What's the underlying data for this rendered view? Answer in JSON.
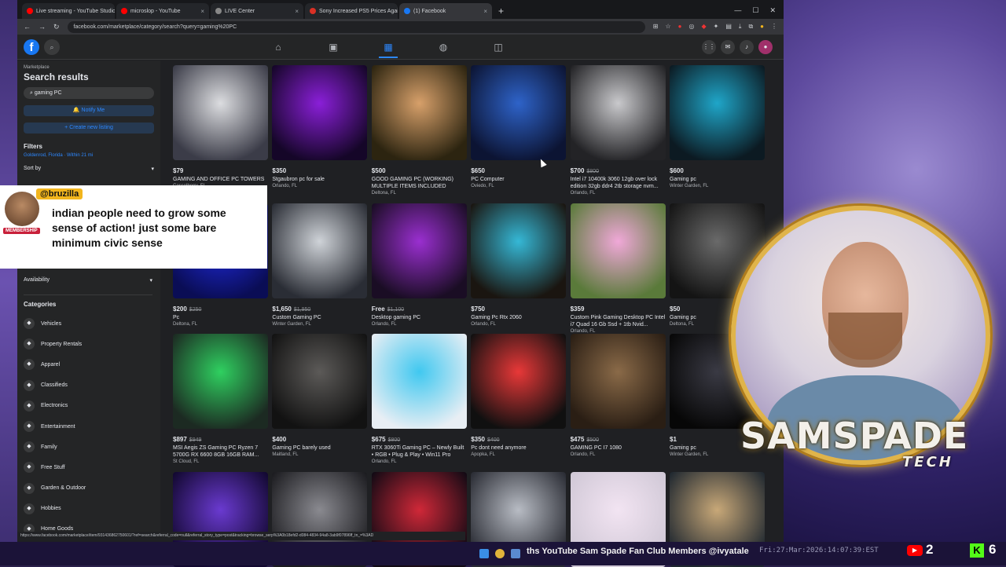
{
  "browser": {
    "tabs": [
      {
        "label": "Live streaming - YouTube Studio",
        "color": "#ff0000"
      },
      {
        "label": "microslop - YouTube",
        "color": "#ff0000"
      },
      {
        "label": "LIVE Center",
        "color": "#888888"
      },
      {
        "label": "Sony Increased PS5 Prices Again",
        "color": "#d93025"
      },
      {
        "label": "(1) Facebook",
        "color": "#1877f2"
      }
    ],
    "url": "facebook.com/marketplace/category/search?query=gaming%20PC",
    "status_url": "https://www.facebook.com/marketplace/item/931436862750601/?ref=search&referral_code=null&referral_story_type=post&tracking=browse_serp%3A0b18efd2-d084-4834-94a8-3ab9f07896ff_tn_=%3AD"
  },
  "fb": {
    "logo": "f",
    "sidebar": {
      "breadcrumb": "Marketplace",
      "title": "Search results",
      "search_value": "gaming PC",
      "notify_label": "Notify Me",
      "create_label": "Create new listing",
      "filters_label": "Filters",
      "location": "Goldenrod, Florida · Within 21 mi",
      "sort_label": "Sort by",
      "availability_label": "Availability",
      "categories_label": "Categories",
      "categories": [
        {
          "label": "Vehicles",
          "icon": "car-icon"
        },
        {
          "label": "Property Rentals",
          "icon": "house-icon"
        },
        {
          "label": "Apparel",
          "icon": "shirt-icon"
        },
        {
          "label": "Classifieds",
          "icon": "tag-icon"
        },
        {
          "label": "Electronics",
          "icon": "phone-icon"
        },
        {
          "label": "Entertainment",
          "icon": "film-icon"
        },
        {
          "label": "Family",
          "icon": "heart-icon"
        },
        {
          "label": "Free Stuff",
          "icon": "gift-icon"
        },
        {
          "label": "Garden & Outdoor",
          "icon": "leaf-icon"
        },
        {
          "label": "Hobbies",
          "icon": "guitar-icon"
        },
        {
          "label": "Home Goods",
          "icon": "sofa-icon"
        }
      ]
    },
    "listings": [
      {
        "price": "$79",
        "old": "",
        "title": "GAMING AND OFFICE PC TOWERS",
        "loc": "Casselberry, FL",
        "c1": "#dcdde0",
        "c2": "#3b3c48"
      },
      {
        "price": "$350",
        "old": "",
        "title": "Stgaubron pc for sale",
        "loc": "Orlando, FL",
        "c1": "#8a1fd8",
        "c2": "#150628"
      },
      {
        "price": "$500",
        "old": "",
        "title": "GOOD GAMING PC (WORKING) MULTIPLE ITEMS INCLUDED",
        "loc": "Deltona, FL",
        "c1": "#d7a06a",
        "c2": "#2c2410"
      },
      {
        "price": "$650",
        "old": "",
        "title": "PC Computer",
        "loc": "Oviedo, FL",
        "c1": "#2e63c9",
        "c2": "#0c1433"
      },
      {
        "price": "$700",
        "old": "$800",
        "title": "Intel i7 10400k 3060 12gb over lock edition 32gb ddr4 2tb storage nvm...",
        "loc": "Orlando, FL",
        "c1": "#c9c9cc",
        "c2": "#232326"
      },
      {
        "price": "$600",
        "old": "",
        "title": "Gaming pc",
        "loc": "Winter Garden, FL",
        "c1": "#1fa6c9",
        "c2": "#0c1a22"
      },
      {
        "price": "$200",
        "old": "$250",
        "title": "Pc",
        "loc": "Deltona, FL",
        "c1": "#1f2ae0",
        "c2": "#0a0d55"
      },
      {
        "price": "$1,650",
        "old": "$1,950",
        "title": "Custom Gaming PC",
        "loc": "Winter Garden, FL",
        "c1": "#cfd3d8",
        "c2": "#2a2d35"
      },
      {
        "price": "Free",
        "old": "$1,100",
        "title": "Desktop gaming PC",
        "loc": "Orlando, FL",
        "c1": "#9a2fd0",
        "c2": "#1a0d24"
      },
      {
        "price": "$750",
        "old": "",
        "title": "Gaming Pc Rtx 2060",
        "loc": "Orlando, FL",
        "c1": "#35b8d6",
        "c2": "#1a1510"
      },
      {
        "price": "$359",
        "old": "",
        "title": "Custom Pink Gaming Desktop PC Intel i7 Quad 16 Gb Ssd + 1tb Nvid...",
        "loc": "Orlando, FL",
        "c1": "#f0a8d8",
        "c2": "#5a7a3a"
      },
      {
        "price": "$50",
        "old": "",
        "title": "Gaming pc",
        "loc": "Deltona, FL",
        "c1": "#6a6a6a",
        "c2": "#141414"
      },
      {
        "price": "$897",
        "old": "$949",
        "title": "MSI Aegis ZS Gaming PC Ryzen 7 5700G RX 6600 8GB 16GB RAM...",
        "loc": "St Cloud, FL",
        "c1": "#2fd060",
        "c2": "#1c2a22"
      },
      {
        "price": "$400",
        "old": "",
        "title": "Gaming PC barely used",
        "loc": "Maitland, FL",
        "c1": "#5c5a58",
        "c2": "#121212"
      },
      {
        "price": "$675",
        "old": "$800",
        "title": "RTX 3060Ti Gaming PC – Newly Built • RGB • Plug & Play • Win11 Pro",
        "loc": "Orlando, FL",
        "c1": "#40c8f0",
        "c2": "#e8eef4"
      },
      {
        "price": "$350",
        "old": "$400",
        "title": "Pc dont need anymore",
        "loc": "Apopka, FL",
        "c1": "#e83838",
        "c2": "#101010"
      },
      {
        "price": "$475",
        "old": "$500",
        "title": "GAMING PC I7 1080",
        "loc": "Orlando, FL",
        "c1": "#8a6a48",
        "c2": "#2a1e14"
      },
      {
        "price": "$1",
        "old": "",
        "title": "Gaming pc",
        "loc": "Winter Garden, FL",
        "c1": "#3a3a44",
        "c2": "#070707"
      },
      {
        "price": "",
        "old": "",
        "title": "",
        "loc": "",
        "c1": "#6a3ad0",
        "c2": "#120830"
      },
      {
        "price": "",
        "old": "",
        "title": "",
        "loc": "",
        "c1": "#8a8a90",
        "c2": "#1c1c20"
      },
      {
        "price": "",
        "old": "",
        "title": "",
        "loc": "",
        "c1": "#d02838",
        "c2": "#120a14"
      },
      {
        "price": "",
        "old": "",
        "title": "",
        "loc": "",
        "c1": "#b8bcc4",
        "c2": "#2a2c34"
      },
      {
        "price": "",
        "old": "",
        "title": "",
        "loc": "",
        "c1": "#f2e4f2",
        "c2": "#d0c8d6"
      },
      {
        "price": "",
        "old": "",
        "title": "",
        "loc": "",
        "c1": "#c8a878",
        "c2": "#202830"
      }
    ]
  },
  "chat": {
    "username": "@bruzilla",
    "badge": "MEMBERSHIP",
    "message": "indian people need to grow some sense of action! just some bare minimum civic sense"
  },
  "overlay": {
    "brand": "SAMSPADE",
    "brand_sub": "TECH",
    "ticker": "ths YouTube Sam Spade Fan Club Members @ivyatale",
    "timestamp": "Fri:27:Mar:2026:14:07:39:EST",
    "youtube_count": "2",
    "kick_count": "6",
    "kick_letter": "K",
    "youtube_icon": "▶"
  }
}
